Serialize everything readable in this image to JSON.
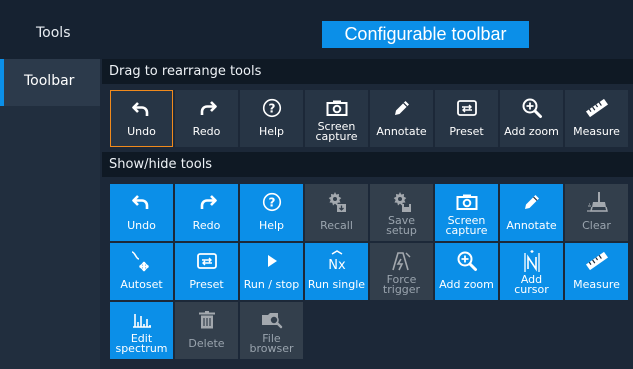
{
  "header": {
    "tools_label": "Tools",
    "callout": "Configurable toolbar"
  },
  "sidebar": {
    "items": [
      {
        "label": "Toolbar",
        "active": true
      }
    ]
  },
  "toolbar_section": {
    "title": "Drag to rearrange tools",
    "tools": [
      {
        "label": "Undo",
        "icon": "undo-icon",
        "selected": true
      },
      {
        "label": "Redo",
        "icon": "redo-icon"
      },
      {
        "label": "Help",
        "icon": "help-icon"
      },
      {
        "label": "Screen\ncapture",
        "icon": "camera-icon"
      },
      {
        "label": "Annotate",
        "icon": "pencil-icon"
      },
      {
        "label": "Preset",
        "icon": "preset-icon"
      },
      {
        "label": "Add zoom",
        "icon": "zoom-in-icon"
      },
      {
        "label": "Measure",
        "icon": "ruler-icon"
      }
    ]
  },
  "showhide_section": {
    "title": "Show/hide tools",
    "tools": [
      {
        "label": "Undo",
        "icon": "undo-icon",
        "state": "shown"
      },
      {
        "label": "Redo",
        "icon": "redo-icon",
        "state": "shown"
      },
      {
        "label": "Help",
        "icon": "help-icon",
        "state": "shown"
      },
      {
        "label": "Recall",
        "icon": "recall-icon",
        "state": "hidden"
      },
      {
        "label": "Save\nsetup",
        "icon": "save-setup-icon",
        "state": "hidden"
      },
      {
        "label": "Screen\ncapture",
        "icon": "camera-icon",
        "state": "shown"
      },
      {
        "label": "Annotate",
        "icon": "pencil-icon",
        "state": "shown"
      },
      {
        "label": "Clear",
        "icon": "clear-icon",
        "state": "hidden"
      },
      {
        "label": "Autoset",
        "icon": "autoset-icon",
        "state": "shown"
      },
      {
        "label": "Preset",
        "icon": "preset-icon",
        "state": "shown"
      },
      {
        "label": "Run / stop",
        "icon": "play-icon",
        "state": "shown"
      },
      {
        "label": "Run single",
        "icon": "run-single-icon",
        "state": "shown"
      },
      {
        "label": "Force\ntrigger",
        "icon": "force-trigger-icon",
        "state": "hidden"
      },
      {
        "label": "Add zoom",
        "icon": "zoom-in-icon",
        "state": "shown"
      },
      {
        "label": "Add\ncursor",
        "icon": "cursor-icon",
        "state": "shown"
      },
      {
        "label": "Measure",
        "icon": "ruler-icon",
        "state": "shown"
      },
      {
        "label": "Edit\nspectrum",
        "icon": "spectrum-icon",
        "state": "shown"
      },
      {
        "label": "Delete",
        "icon": "trash-icon",
        "state": "hidden"
      },
      {
        "label": "File\nbrowser",
        "icon": "file-browser-icon",
        "state": "hidden"
      }
    ]
  },
  "colors": {
    "accent": "#0b8fe8",
    "selected_border": "#f08a1c",
    "hidden_tile": "#333f4c"
  }
}
